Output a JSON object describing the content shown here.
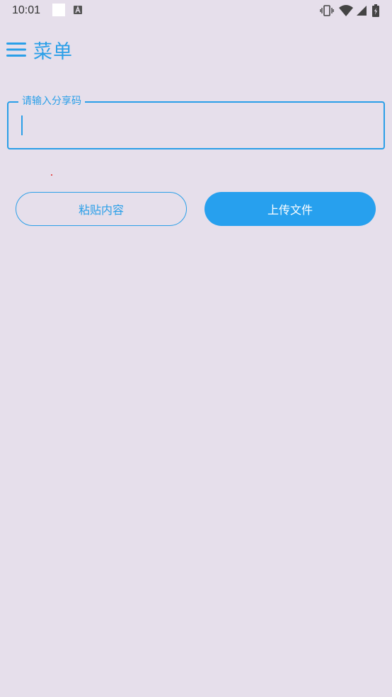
{
  "status_bar": {
    "time": "10:01",
    "icons": [
      "notification-square-icon",
      "a-icon",
      "vibrate-icon",
      "wifi-icon",
      "signal-icon",
      "battery-icon"
    ]
  },
  "header": {
    "menu_label": "菜单",
    "menu_icon": "hamburger-icon"
  },
  "share_code_field": {
    "label": "请输入分享码",
    "value": ""
  },
  "buttons": {
    "paste_label": "粘贴内容",
    "upload_label": "上传文件"
  },
  "colors": {
    "background": "#e6dfeb",
    "accent": "#2a9fe8",
    "upload_button_bg": "#27a0ee"
  }
}
